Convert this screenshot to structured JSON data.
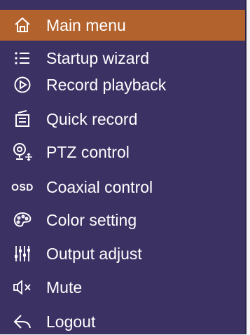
{
  "menu": {
    "items": [
      {
        "label": "Main menu",
        "icon": "home-icon",
        "active": true
      },
      {
        "label": "Startup wizard",
        "icon": "list-icon"
      },
      {
        "label": "Record playback",
        "icon": "play-circle-icon"
      },
      {
        "label": "Quick record",
        "icon": "record-device-icon"
      },
      {
        "label": "PTZ control",
        "icon": "ptz-camera-icon"
      },
      {
        "label": "Coaxial control",
        "icon": "osd-icon",
        "icon_text": "OSD"
      },
      {
        "label": "Color setting",
        "icon": "palette-icon"
      },
      {
        "label": "Output adjust",
        "icon": "sliders-icon"
      },
      {
        "label": "Mute",
        "icon": "mute-speaker-icon"
      },
      {
        "label": "Logout",
        "icon": "logout-arrow-icon"
      }
    ]
  },
  "colors": {
    "menu_bg": "#3c3163",
    "active_bg": "#b2622d",
    "text": "#ffffff"
  }
}
